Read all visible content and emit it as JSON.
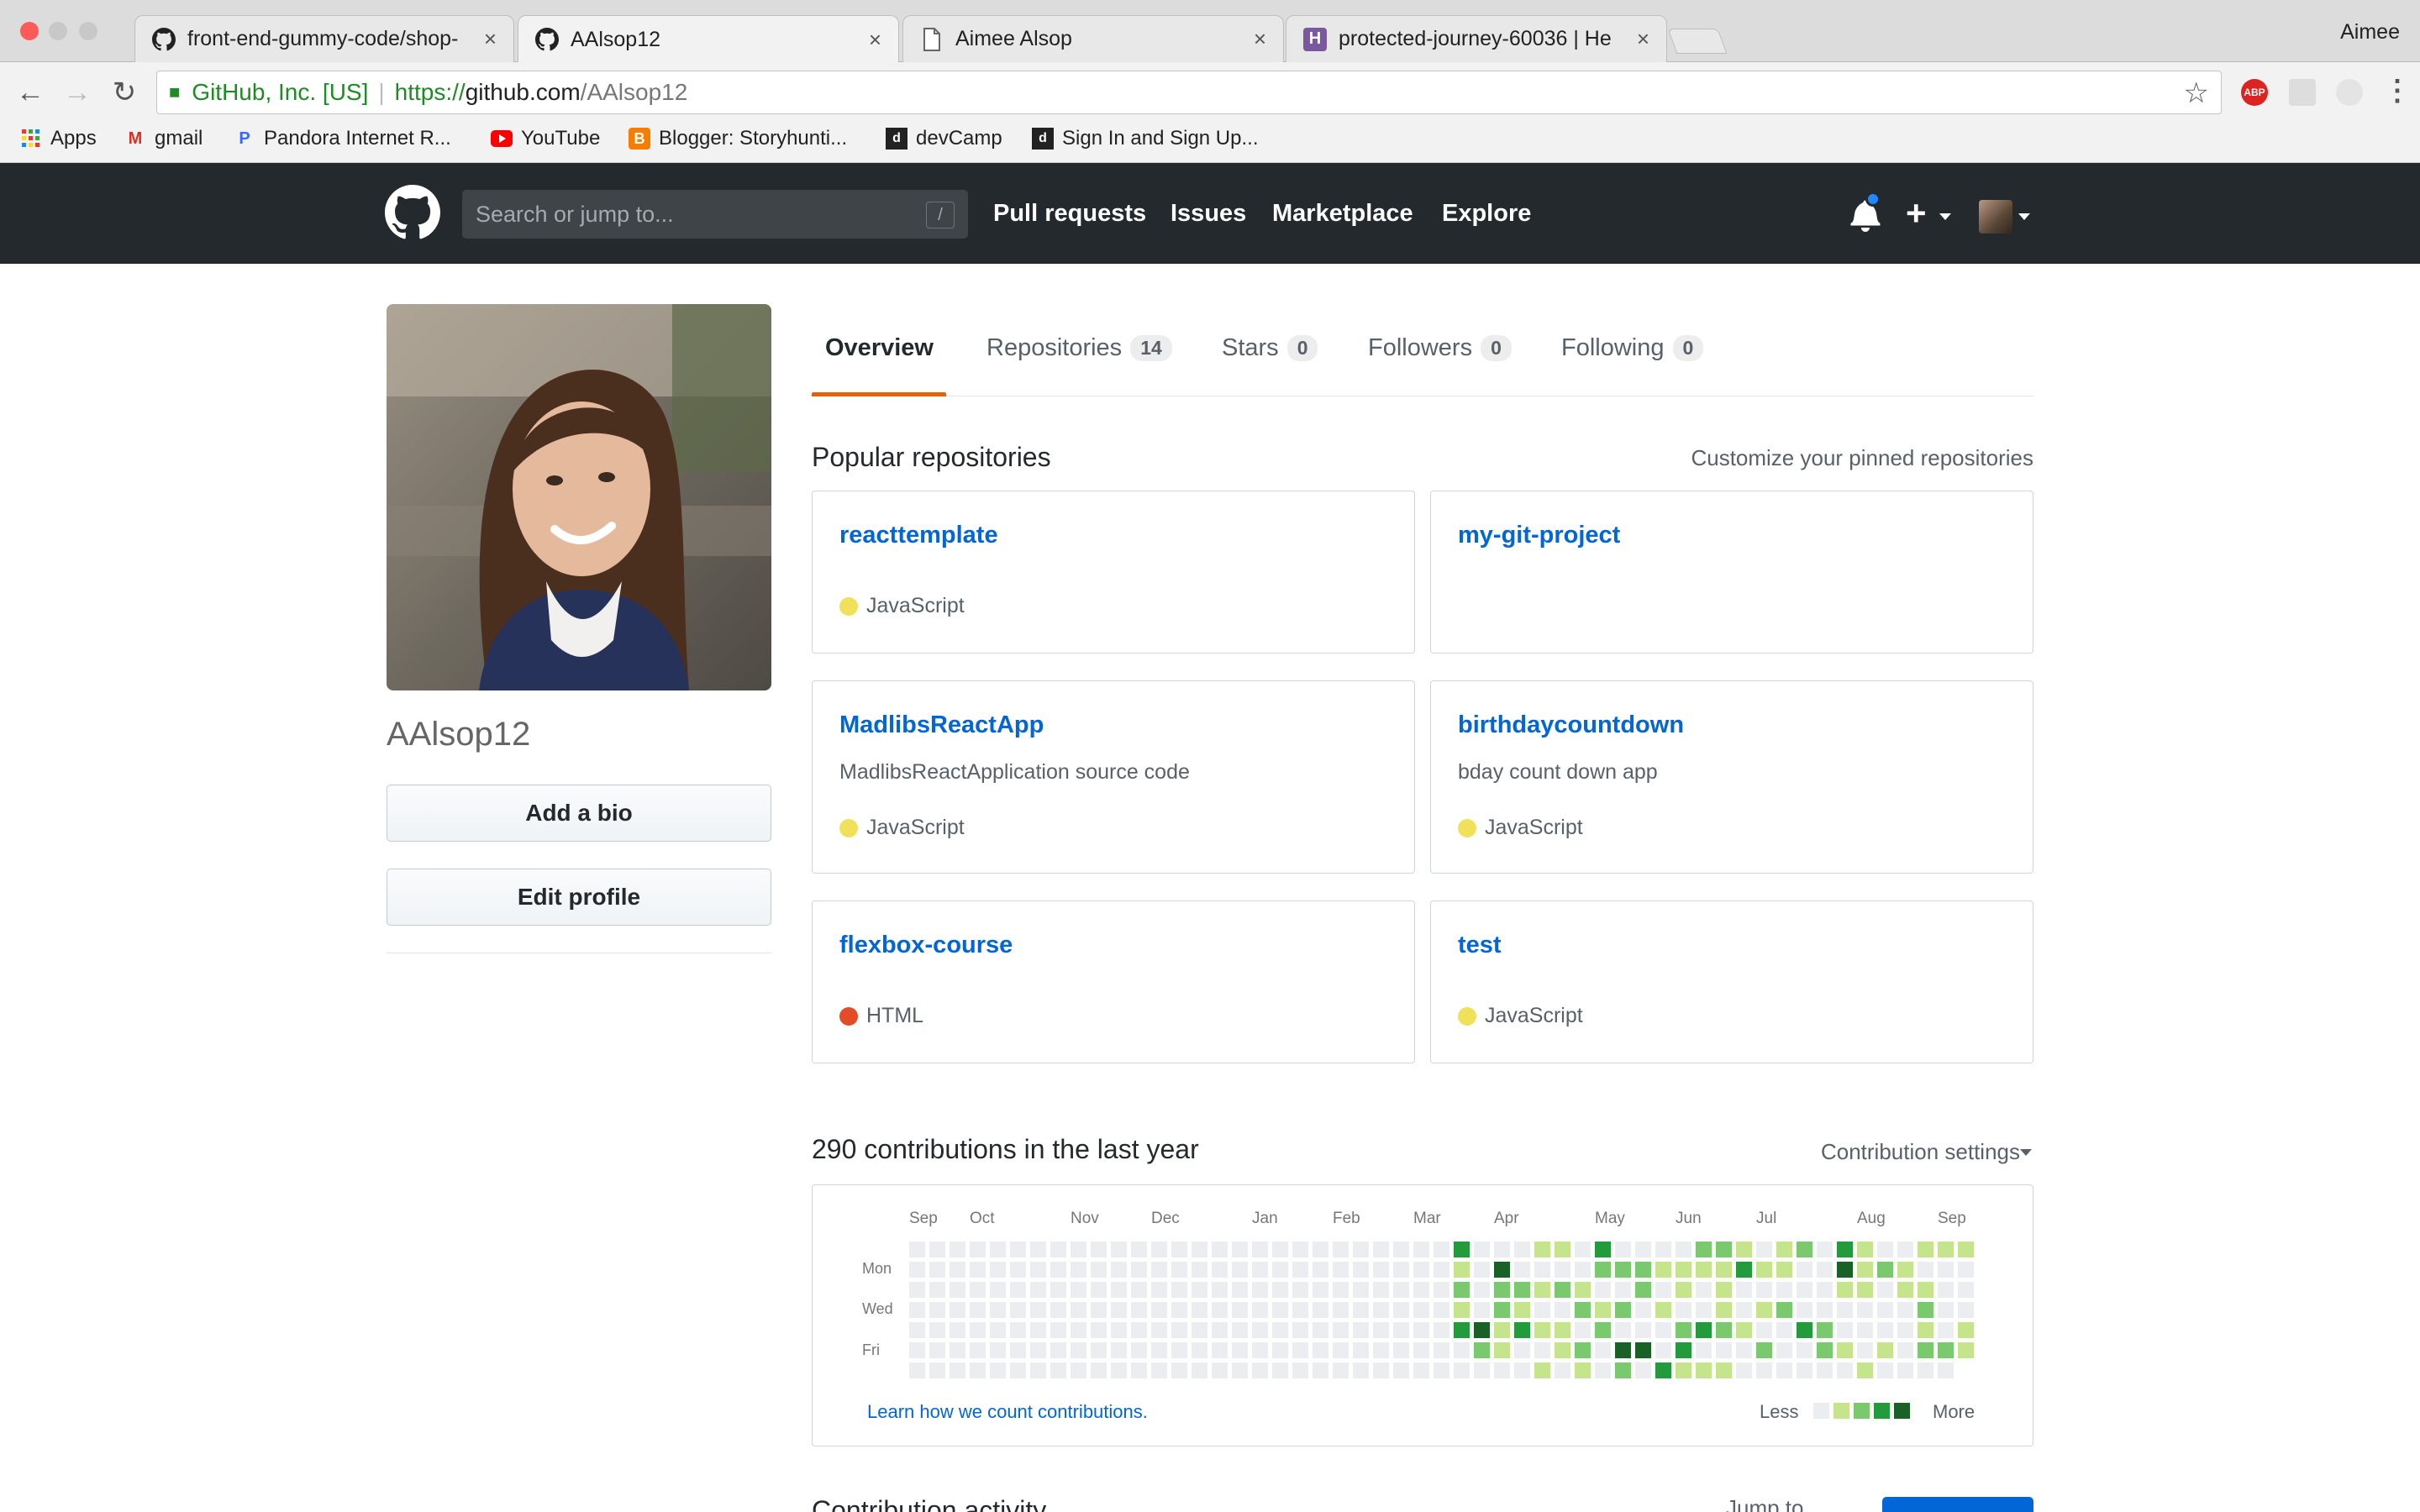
{
  "browser": {
    "tabs": [
      {
        "title": "front-end-gummy-code/shop-",
        "icon": "github-icon"
      },
      {
        "title": "AAlsop12",
        "icon": "github-icon"
      },
      {
        "title": "Aimee Alsop",
        "icon": "document-icon"
      },
      {
        "title": "protected-journey-60036 | He",
        "icon": "heroku-icon"
      }
    ],
    "close_glyph": "×",
    "profile_name": "Aimee",
    "address": {
      "site_name": "GitHub, Inc. [US]",
      "separator": "|",
      "protocol": "https://",
      "host": "github.com",
      "path": "/AAlsop12"
    },
    "bookmarks": [
      {
        "label": "Apps",
        "icon": "apps-grid-icon"
      },
      {
        "label": "gmail",
        "icon": "gmail-icon"
      },
      {
        "label": "Pandora Internet R...",
        "icon": "pandora-icon"
      },
      {
        "label": "YouTube",
        "icon": "youtube-icon"
      },
      {
        "label": "Blogger: Storyhunti...",
        "icon": "blogger-icon"
      },
      {
        "label": "devCamp",
        "icon": "devcamp-icon"
      },
      {
        "label": "Sign In and Sign Up...",
        "icon": "devcamp-icon"
      }
    ],
    "extensions": {
      "abp_label": "ABP"
    }
  },
  "header": {
    "search_placeholder": "Search or jump to...",
    "search_shortcut": "/",
    "nav": [
      "Pull requests",
      "Issues",
      "Marketplace",
      "Explore"
    ],
    "plus_glyph": "+"
  },
  "profile": {
    "username": "AAlsop12",
    "add_bio_label": "Add a bio",
    "edit_profile_label": "Edit profile"
  },
  "tabs": [
    {
      "label": "Overview",
      "count": null
    },
    {
      "label": "Repositories",
      "count": "14"
    },
    {
      "label": "Stars",
      "count": "0"
    },
    {
      "label": "Followers",
      "count": "0"
    },
    {
      "label": "Following",
      "count": "0"
    }
  ],
  "popular": {
    "title": "Popular repositories",
    "customize_link": "Customize your pinned repositories",
    "repos": [
      {
        "name": "reacttemplate",
        "description": "",
        "language": "JavaScript",
        "lang_color": "#f1e05a"
      },
      {
        "name": "my-git-project",
        "description": "",
        "language": "",
        "lang_color": ""
      },
      {
        "name": "MadlibsReactApp",
        "description": "MadlibsReactApplication source code",
        "language": "JavaScript",
        "lang_color": "#f1e05a"
      },
      {
        "name": "birthdaycountdown",
        "description": "bday count down app",
        "language": "JavaScript",
        "lang_color": "#f1e05a"
      },
      {
        "name": "flexbox-course",
        "description": "",
        "language": "HTML",
        "lang_color": "#e34c26"
      },
      {
        "name": "test",
        "description": "",
        "language": "JavaScript",
        "lang_color": "#f1e05a"
      }
    ]
  },
  "contributions": {
    "title": "290 contributions in the last year",
    "settings_label": "Contribution settings",
    "months": [
      "Sep",
      "Oct",
      "Nov",
      "Dec",
      "Jan",
      "Feb",
      "Mar",
      "Apr",
      "May",
      "Jun",
      "Jul",
      "Aug",
      "Sep"
    ],
    "day_labels": [
      "Mon",
      "Wed",
      "Fri"
    ],
    "learn_link": "Learn how we count contributions.",
    "legend_less": "Less",
    "legend_more": "More",
    "colors": [
      "#ebedf0",
      "#c6e48b",
      "#7bc96f",
      "#239a3b",
      "#196127"
    ]
  },
  "activity": {
    "title": "Contribution activity",
    "jump_label": "Jump to"
  }
}
